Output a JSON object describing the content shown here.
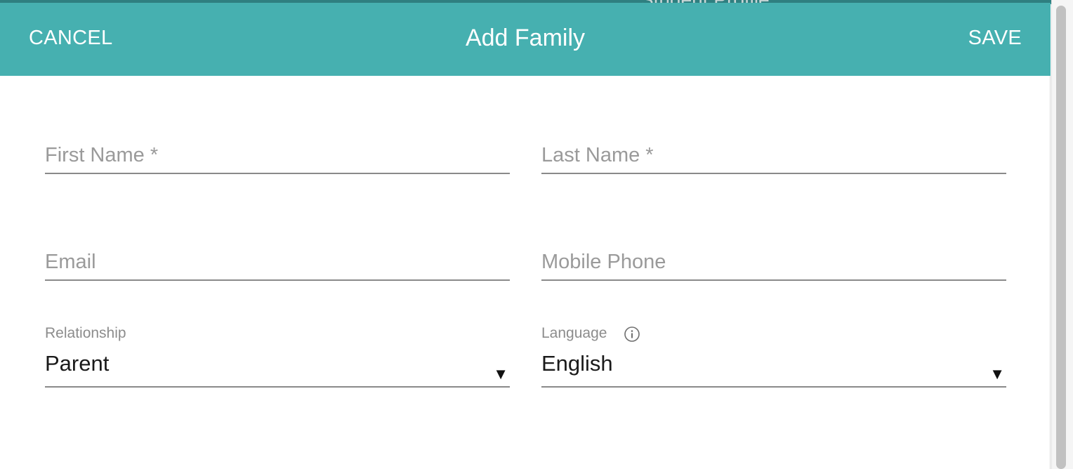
{
  "background": {
    "title": "Student Profile"
  },
  "dialog": {
    "title": "Add Family",
    "cancel_label": "CANCEL",
    "save_label": "SAVE",
    "header_color": "#46b0b0"
  },
  "form": {
    "first_name": {
      "placeholder": "First Name *",
      "value": ""
    },
    "last_name": {
      "placeholder": "Last Name *",
      "value": ""
    },
    "email": {
      "placeholder": "Email",
      "value": ""
    },
    "mobile_phone": {
      "placeholder": "Mobile Phone",
      "value": ""
    },
    "relationship": {
      "label": "Relationship",
      "value": "Parent",
      "icon": "caret-down-icon"
    },
    "language": {
      "label": "Language",
      "value": "English",
      "info_icon": "info-icon",
      "icon": "caret-down-icon"
    }
  }
}
